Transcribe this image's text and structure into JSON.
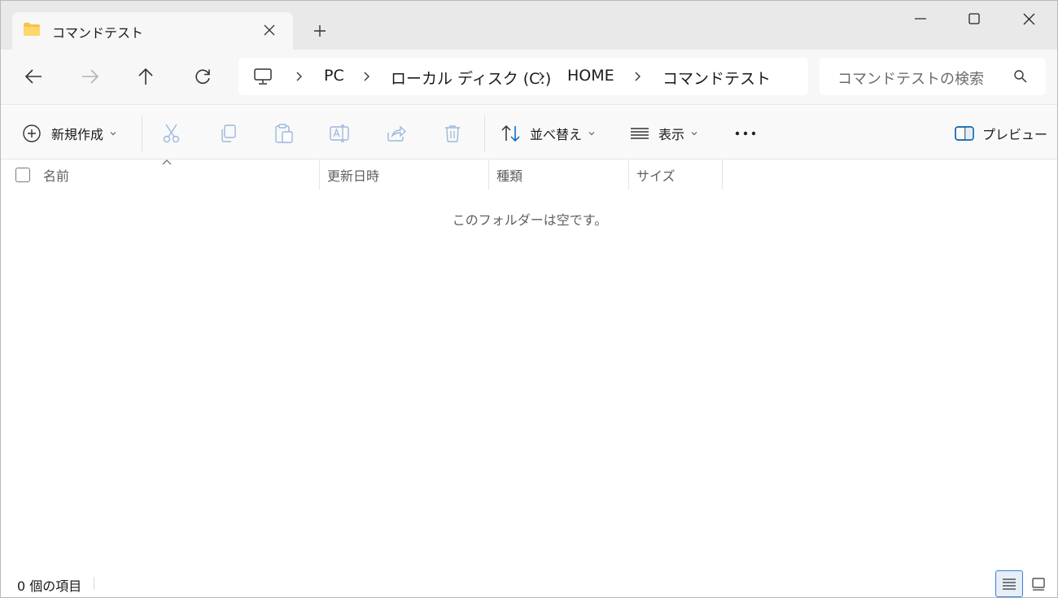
{
  "tab": {
    "title": "コマンドテスト"
  },
  "address": {
    "crumbs": [
      "PC",
      "ローカル ディスク (C:)",
      "HOME",
      "コマンドテスト"
    ]
  },
  "search": {
    "placeholder": "コマンドテストの検索"
  },
  "commands": {
    "new_label": "新規作成",
    "sort_label": "並べ替え",
    "view_label": "表示",
    "preview_label": "プレビュー"
  },
  "columns": [
    "名前",
    "更新日時",
    "種類",
    "サイズ"
  ],
  "content": {
    "empty_message": "このフォルダーは空です。"
  },
  "status": {
    "item_count": "0 個の項目"
  },
  "colors": {
    "accent": "#0067c0",
    "folder": "#f4c44e"
  }
}
